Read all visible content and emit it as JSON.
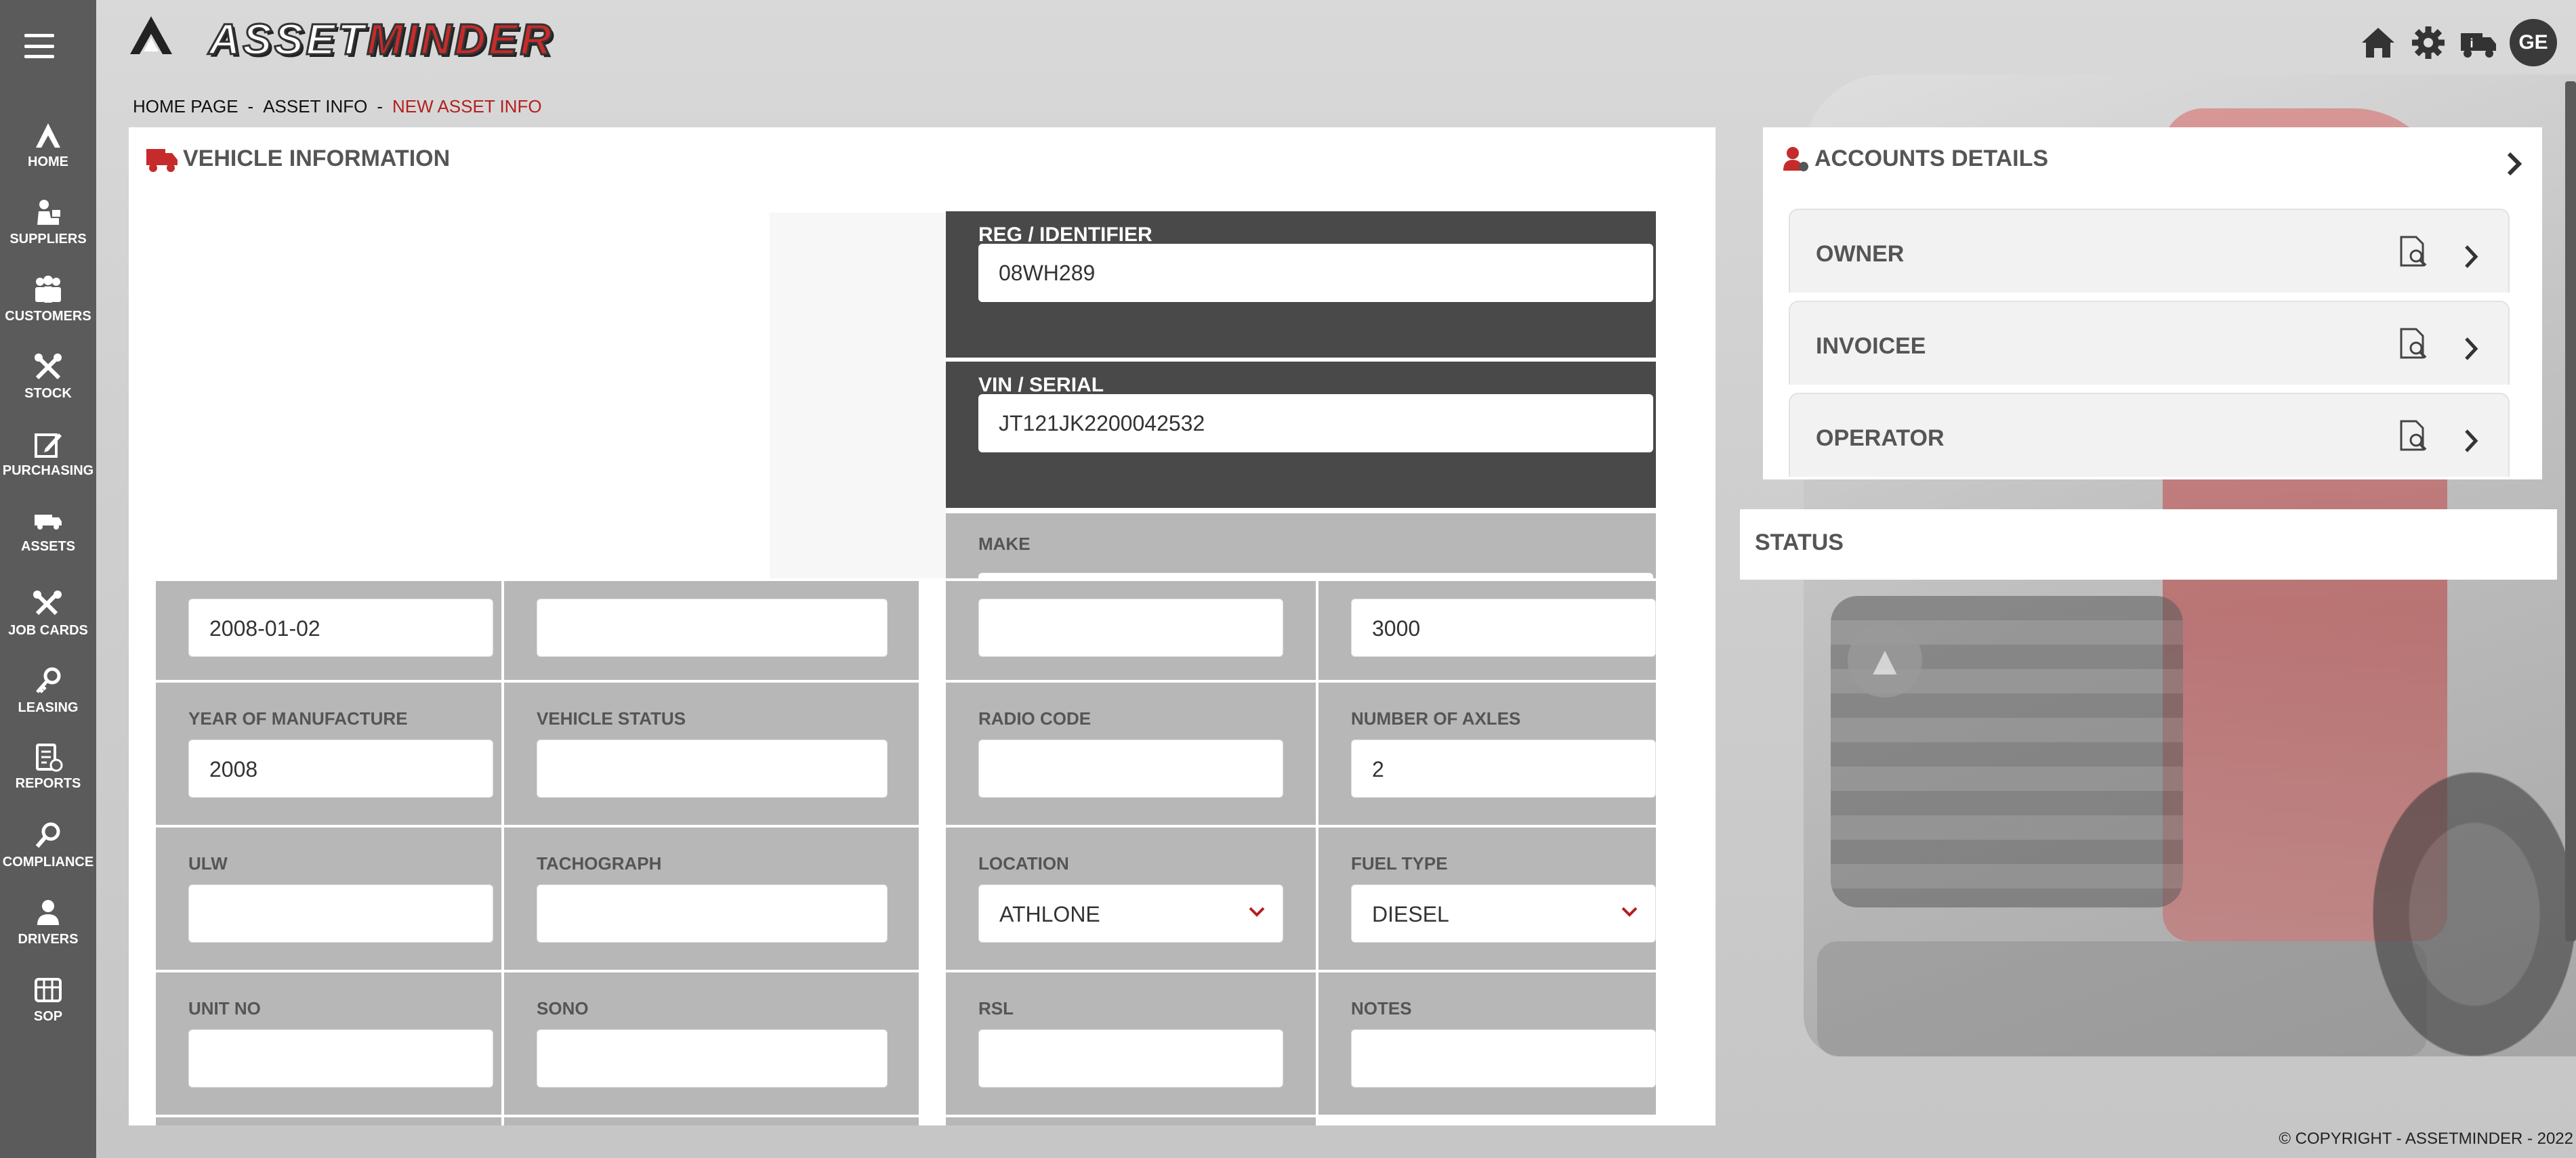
{
  "app": {
    "logo_word_a": "ASSET",
    "logo_word_b": "MINDER",
    "avatar_initials": "GE",
    "copyright": "© COPYRIGHT - ASSETMINDER - 2022"
  },
  "sidebar": {
    "items": [
      {
        "label": "HOME",
        "icon": "home-logo-icon"
      },
      {
        "label": "SUPPLIERS",
        "icon": "suppliers-icon"
      },
      {
        "label": "CUSTOMERS",
        "icon": "customers-icon"
      },
      {
        "label": "STOCK",
        "icon": "stock-icon"
      },
      {
        "label": "PURCHASING",
        "icon": "purchasing-icon"
      },
      {
        "label": "ASSETS",
        "icon": "assets-icon"
      },
      {
        "label": "JOB CARDS",
        "icon": "job-cards-icon"
      },
      {
        "label": "LEASING",
        "icon": "leasing-icon"
      },
      {
        "label": "REPORTS",
        "icon": "reports-icon"
      },
      {
        "label": "COMPLIANCE",
        "icon": "compliance-icon"
      },
      {
        "label": "DRIVERS",
        "icon": "drivers-icon"
      },
      {
        "label": "SOP",
        "icon": "sop-icon"
      }
    ]
  },
  "breadcrumb": {
    "items": [
      "HOME PAGE",
      "ASSET INFO"
    ],
    "separator": "-",
    "current": "NEW ASSET INFO"
  },
  "vehicle": {
    "title": "VEHICLE INFORMATION",
    "reg_label": "REG / IDENTIFIER",
    "reg_value": "08WH289",
    "vin_label": "VIN / SERIAL",
    "vin_value": "JT121JK2200042532",
    "make_label": "MAKE",
    "row1": [
      "2008-01-02",
      "",
      "",
      "3000"
    ],
    "fields": [
      {
        "label": "YEAR OF MANUFACTURE",
        "value": ""
      },
      {
        "label": "VEHICLE STATUS",
        "value": ""
      },
      {
        "label": "RADIO CODE",
        "value": ""
      },
      {
        "label": "NUMBER OF AXLES",
        "value": "2"
      },
      {
        "label": "ULW",
        "value": ""
      },
      {
        "label": "TACHOGRAPH",
        "value": ""
      },
      {
        "label": "LOCATION",
        "value": "ATHLONE"
      },
      {
        "label": "FUEL TYPE",
        "value": "DIESEL"
      },
      {
        "label": "UNIT NO",
        "value": ""
      },
      {
        "label": "SONO",
        "value": ""
      },
      {
        "label": "RSL",
        "value": ""
      },
      {
        "label": "NOTES",
        "value": ""
      }
    ],
    "year_value": "2008"
  },
  "accounts": {
    "title": "ACCOUNTS DETAILS",
    "rows": [
      "OWNER",
      "INVOICEE",
      "OPERATOR"
    ]
  },
  "status": {
    "title": "STATUS"
  },
  "colors": {
    "sidebar_bg": "#5b5b5b",
    "accent_red": "#b41f1f",
    "dark_field_bg": "#494949",
    "grid_cell_bg": "#b7b7b7"
  }
}
